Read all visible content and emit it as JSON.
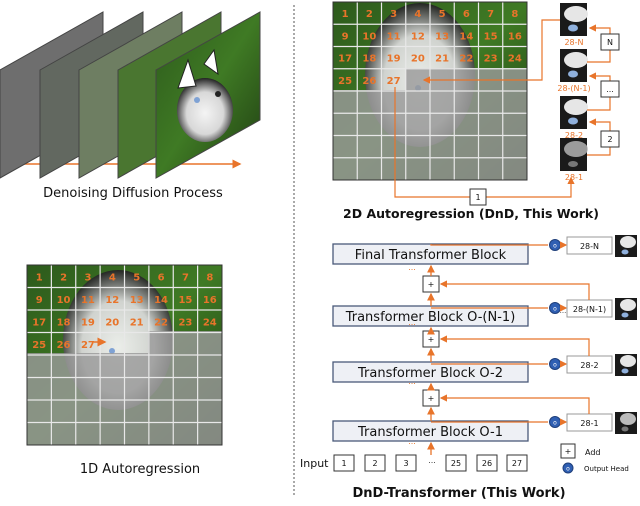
{
  "captions": {
    "diffusion": "Denoising Diffusion Process",
    "ar1d": "1D Autoregression",
    "ar2d": "2D Autoregression (DnD, This Work)",
    "dnd_transformer": "DnD-Transformer (This Work)"
  },
  "grid": {
    "rows": 8,
    "cols": 8,
    "visible_tokens": [
      "1",
      "2",
      "3",
      "4",
      "5",
      "6",
      "7",
      "8",
      "9",
      "10",
      "11",
      "12",
      "13",
      "14",
      "15",
      "16",
      "17",
      "18",
      "19",
      "20",
      "21",
      "22",
      "23",
      "24",
      "25",
      "26",
      "27"
    ]
  },
  "depth_stack": {
    "labels": [
      "28-N",
      "28-(N-1)",
      "28-2",
      "28-1"
    ],
    "steps": [
      "N",
      "...",
      "2",
      "1"
    ]
  },
  "transformer": {
    "blocks": [
      "Final Transformer Block",
      "Transformer Block O-(N-1)",
      "Transformer Block O-2",
      "Transformer Block O-1"
    ],
    "outputs": [
      "28-N",
      "28-(N-1)",
      "28-2",
      "28-1"
    ],
    "input_label": "Input",
    "inputs": [
      "1",
      "2",
      "3",
      "...",
      "25",
      "26",
      "27"
    ],
    "ellipsis": "...",
    "add_symbol": "+",
    "head_symbol": "o"
  },
  "legend": {
    "add": "Add",
    "output_head": "Output Head"
  },
  "colors": {
    "accent": "#e8742a",
    "head": "#2f5fb3",
    "block_fill": "#eef0f5",
    "block_border": "#4a5a7a"
  }
}
